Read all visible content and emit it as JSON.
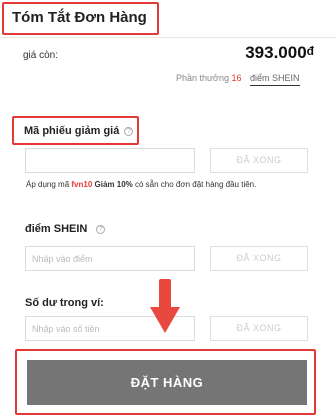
{
  "summary": {
    "title": "Tóm Tắt Đơn Hàng",
    "price_label": "giá còn:",
    "price_value": "393.000",
    "currency": "đ",
    "reward_prefix": "Phần thưởng",
    "reward_points": "16",
    "reward_unit": "điểm SHEIN"
  },
  "coupon": {
    "title": "Mã phiếu giảm giá",
    "help_icon": "question-icon",
    "input_placeholder": "",
    "button_label": "ĐÃ XONG",
    "promo_prefix": "Áp dụng mã",
    "promo_code": "fvn10",
    "promo_discount": "Giảm 10%",
    "promo_suffix": "có sẵn cho đơn đặt hàng đầu tiên."
  },
  "points": {
    "title": "điểm SHEIN",
    "help_icon": "question-icon",
    "input_placeholder": "Nhập vào điểm",
    "button_label": "ĐÃ XONG"
  },
  "wallet": {
    "title": "Số dư trong ví:",
    "input_placeholder": "Nhập vào số tiền",
    "button_label": "ĐÃ XONG"
  },
  "order": {
    "button_label": "ĐẶT HÀNG"
  },
  "colors": {
    "highlight": "#e53935",
    "order_button": "#757575",
    "arrow": "#e8483e"
  }
}
